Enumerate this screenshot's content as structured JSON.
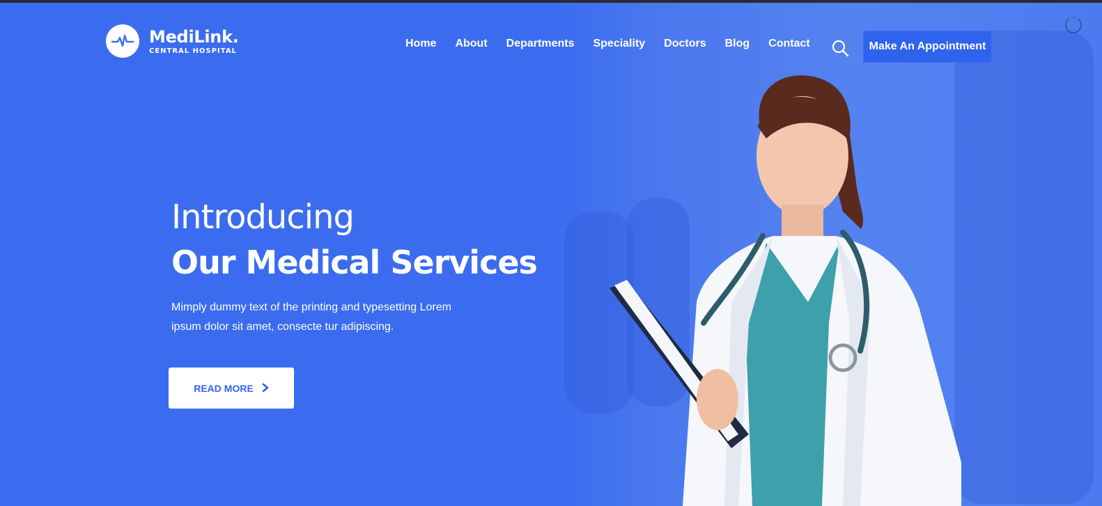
{
  "brand": {
    "name": "MediLink.",
    "subtitle": "CENTRAL HOSPITAL"
  },
  "nav": {
    "items": [
      "Home",
      "About",
      "Departments",
      "Speciality",
      "Doctors",
      "Blog",
      "Contact"
    ],
    "cta_label": "Make An Appointment",
    "search_icon": "search-icon"
  },
  "hero": {
    "intro": "Introducing",
    "headline": "Our Medical Services",
    "description": "Mimply dummy text of the printing and typesetting Lorem ipsum dolor sit amet, consecte tur adipiscing.",
    "button_label": "READ MORE",
    "button_icon": "chevron-right-icon"
  },
  "colors": {
    "primary": "#3b6cf0",
    "button_dark": "#2f63ee",
    "white": "#ffffff"
  }
}
